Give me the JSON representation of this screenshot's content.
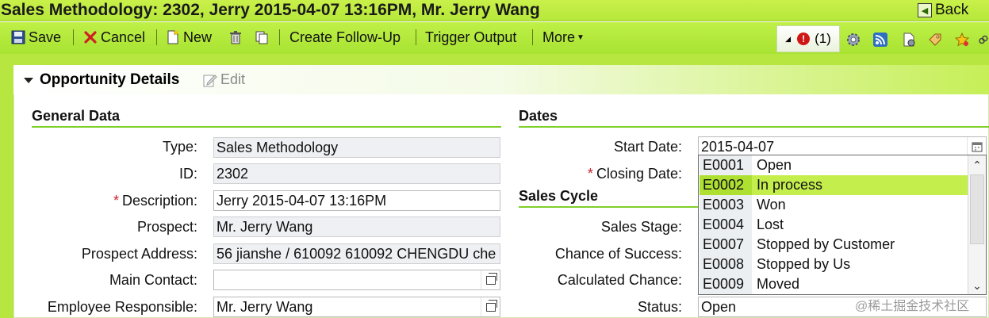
{
  "window": {
    "title": "Sales Methodology: 2302, Jerry 2015-04-07 13:16PM, Mr. Jerry Wang",
    "back_label": "Back"
  },
  "toolbar": {
    "save": "Save",
    "cancel": "Cancel",
    "new": "New",
    "create_follow_up": "Create Follow-Up",
    "trigger_output": "Trigger Output",
    "more": "More",
    "alert_count": "(1)"
  },
  "panel": {
    "title": "Opportunity Details",
    "edit_label": "Edit"
  },
  "general_data": {
    "heading": "General Data",
    "type": {
      "label": "Type:",
      "value": "Sales Methodology"
    },
    "id": {
      "label": "ID:",
      "value": "2302"
    },
    "description": {
      "label": "Description:",
      "value": "Jerry 2015-04-07 13:16PM",
      "required_mark": "*"
    },
    "prospect": {
      "label": "Prospect:",
      "value": "Mr. Jerry Wang"
    },
    "prospect_address": {
      "label": "Prospect Address:",
      "value": "56 jianshe / 610092 610092 CHENGDU che"
    },
    "main_contact": {
      "label": "Main Contact:",
      "value": ""
    },
    "employee_responsible": {
      "label": "Employee Responsible:",
      "value": "Mr. Jerry Wang"
    }
  },
  "dates": {
    "heading": "Dates",
    "start_date": {
      "label": "Start Date:",
      "value": "2015-04-07"
    },
    "closing_date": {
      "label": "Closing Date:",
      "required_mark": "*"
    }
  },
  "sales_cycle": {
    "heading": "Sales Cycle",
    "sales_stage": {
      "label": "Sales Stage:"
    },
    "chance_of_success": {
      "label": "Chance of Success:"
    },
    "calculated_chance": {
      "label": "Calculated Chance:"
    },
    "status": {
      "label": "Status:",
      "value": "Open"
    }
  },
  "status_dropdown": {
    "selected_index": 1,
    "options": [
      {
        "key": "E0001",
        "text": "Open"
      },
      {
        "key": "E0002",
        "text": "In process"
      },
      {
        "key": "E0003",
        "text": "Won"
      },
      {
        "key": "E0004",
        "text": "Lost"
      },
      {
        "key": "E0007",
        "text": "Stopped by Customer"
      },
      {
        "key": "E0008",
        "text": "Stopped by Us"
      },
      {
        "key": "E0009",
        "text": "Moved"
      }
    ]
  },
  "watermark": "@稀土掘金技术社区",
  "colors": {
    "accent": "#b7e640",
    "selection": "#c4ee4c",
    "required": "#c8232c"
  }
}
